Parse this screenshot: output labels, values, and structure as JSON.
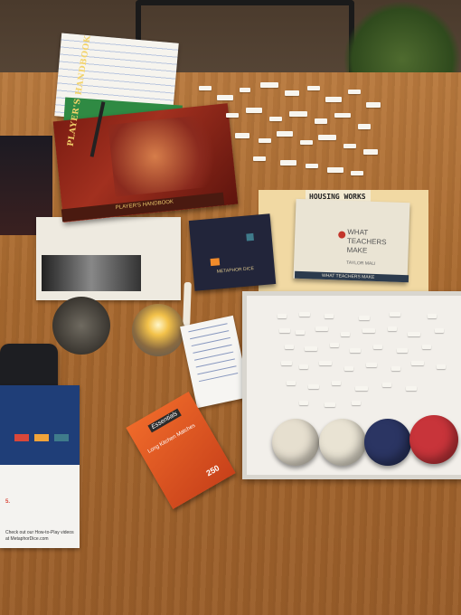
{
  "scene": {
    "description_labels": {
      "dnd_book_title": "PLAYER'S HANDBOOK",
      "dnd_book_spine": "PLAYER'S HANDBOOK",
      "metaphor_dice_box": "METAPHOR DICE",
      "teachers_book_title": "WHAT TEACHERS MAKE",
      "teachers_book_author": "TAYLOR MALI",
      "teachers_book_spine": "WHAT TEACHERS MAKE",
      "sticky_note": "HOUSING WORKS",
      "matches_brand": "Essentials",
      "matches_subtitle": "Long Kitchen Matches",
      "matches_count": "250",
      "leaflet_step5": "5.",
      "leaflet_footer": "Check out our How-to-Play videos at MetaphorDice.com"
    },
    "colors": {
      "table": "#a8692f",
      "book_red": "#7a1c12",
      "metaphor_box": "#22253a",
      "die_1": "#e6dfcf",
      "die_2": "#e9e3d3",
      "die_3": "#2b3563",
      "die_4": "#c8343a"
    }
  }
}
